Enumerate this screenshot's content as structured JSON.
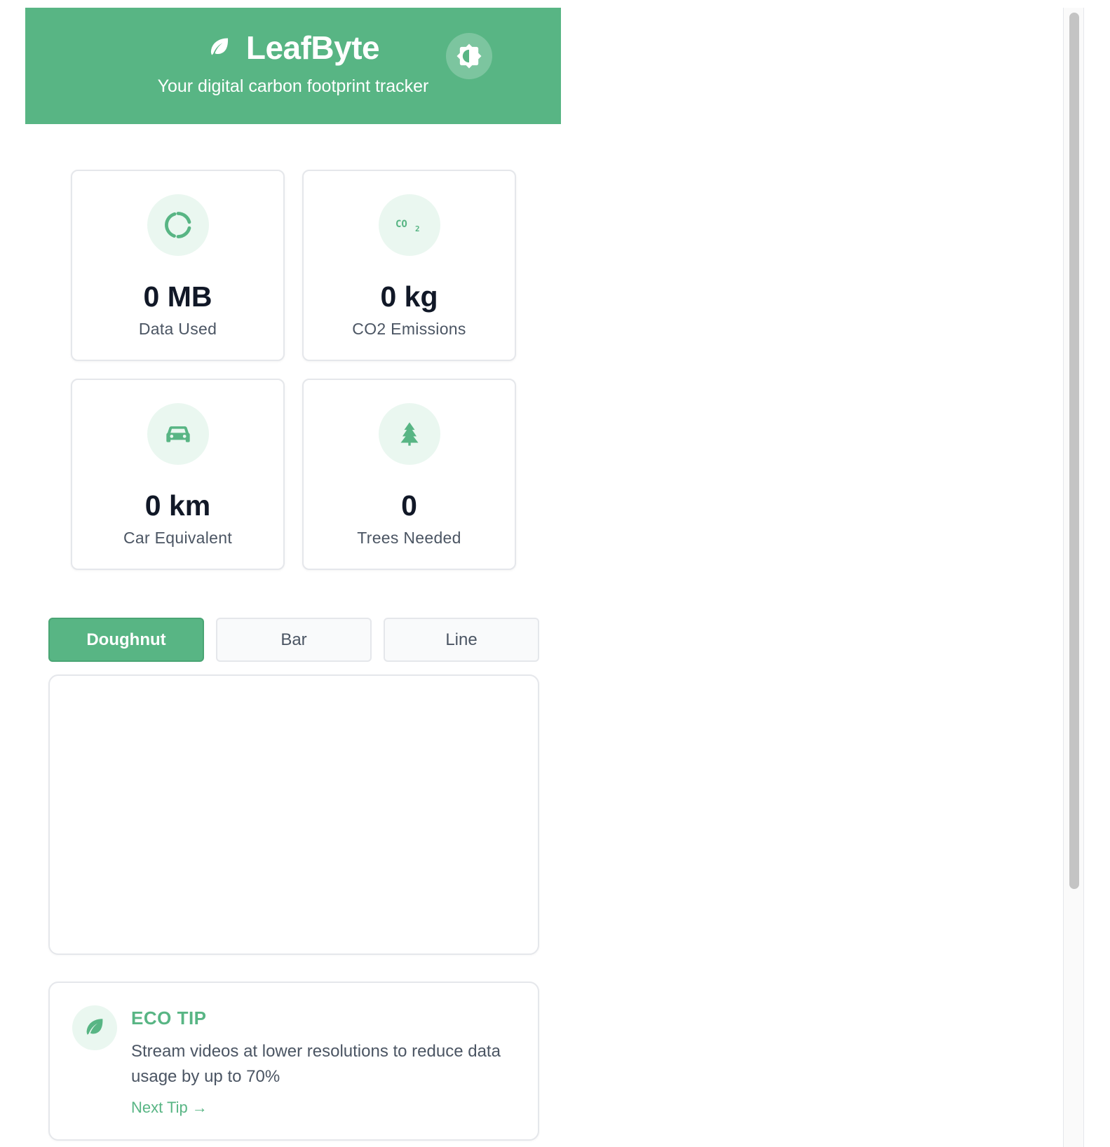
{
  "header": {
    "title": "LeafByte",
    "subtitle": "Your digital carbon footprint tracker",
    "logo_icon": "leaf-icon",
    "theme_toggle_icon": "brightness-icon",
    "background_color": "#58b584"
  },
  "stats": [
    {
      "icon": "loading-ring-icon",
      "value": "0 MB",
      "label": "Data Used"
    },
    {
      "icon": "co2-icon",
      "value": "0 kg",
      "label": "CO2 Emissions"
    },
    {
      "icon": "car-icon",
      "value": "0 km",
      "label": "Car Equivalent"
    },
    {
      "icon": "tree-icon",
      "value": "0",
      "label": "Trees Needed"
    }
  ],
  "chart_tabs": {
    "items": [
      "Doughnut",
      "Bar",
      "Line"
    ],
    "selected": "Doughnut"
  },
  "eco_tip": {
    "icon": "leaf-icon",
    "title": "ECO TIP",
    "text": "Stream videos at lower resolutions to reduce data usage by up to 70%",
    "next_label": "Next Tip →"
  },
  "colors": {
    "accent": "#58b584",
    "icon_bg": "#eaf7f0",
    "muted_text": "#4b5563",
    "border": "#e5e7eb"
  }
}
